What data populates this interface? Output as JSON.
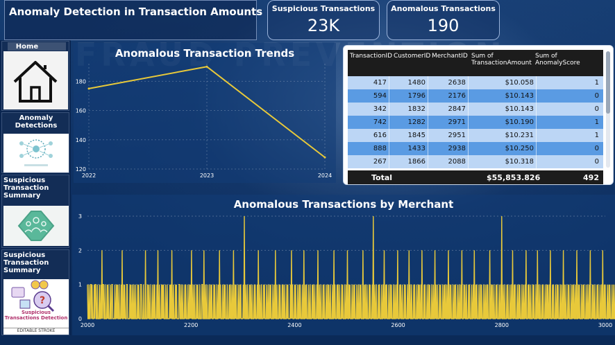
{
  "header": {
    "title": "Anomaly Detection in Transaction Amounts",
    "kpis": [
      {
        "label": "Suspicious Transactions",
        "value": "23K"
      },
      {
        "label": "Anomalous Transactions",
        "value": "190"
      }
    ]
  },
  "sidebar": {
    "items": [
      {
        "label": "Home",
        "icon": "home-icon"
      },
      {
        "label": "Anomaly Detections",
        "icon": "network-diagram-icon"
      },
      {
        "label": "Suspicious Transaction Summary",
        "icon": "people-diamond-icon"
      },
      {
        "label": "Suspicious Transaction Summary",
        "icon": "fraud-detection-icon",
        "thumb_text": "Suspicious Transactions Detection",
        "thumb_caption": "EDITABLE STROKE"
      }
    ]
  },
  "trends": {
    "title": "Anomalous Transaction Trends",
    "line_color": "#e8c93a"
  },
  "table": {
    "columns": [
      "TransactionID",
      "CustomerID",
      "MerchantID",
      "Sum of TransactionAmount",
      "Sum of AnomalyScore"
    ],
    "rows": [
      [
        "417",
        "1480",
        "2638",
        "$10.058",
        "1"
      ],
      [
        "594",
        "1796",
        "2176",
        "$10.143",
        "0"
      ],
      [
        "342",
        "1832",
        "2847",
        "$10.143",
        "0"
      ],
      [
        "742",
        "1282",
        "2971",
        "$10.190",
        "1"
      ],
      [
        "616",
        "1845",
        "2951",
        "$10.231",
        "1"
      ],
      [
        "888",
        "1433",
        "2938",
        "$10.250",
        "0"
      ],
      [
        "267",
        "1866",
        "2088",
        "$10.318",
        "0"
      ]
    ],
    "total": {
      "label": "Total",
      "amount": "$55,853.826",
      "score": "492"
    },
    "row_colors": [
      "#bcd6f5",
      "#5a9be3"
    ]
  },
  "merchant": {
    "title": "Anomalous Transactions by Merchant",
    "line_color": "#e8c93a"
  },
  "chart_data": [
    {
      "type": "line",
      "title": "Anomalous Transaction Trends",
      "x": [
        2022,
        2023,
        2024
      ],
      "values": [
        175,
        190,
        128
      ],
      "xlim": [
        2022,
        2024
      ],
      "ylim": [
        120,
        192
      ],
      "yticks": [
        120,
        140,
        160,
        180
      ],
      "xticks": [
        "2022",
        "2023",
        "2024"
      ],
      "grid": true
    },
    {
      "type": "area",
      "title": "Anomalous Transactions by Merchant",
      "xlim": [
        2000,
        3000
      ],
      "ylim": [
        0,
        3
      ],
      "xticks": [
        "2000",
        "2200",
        "2400",
        "2600",
        "2800",
        "3000"
      ],
      "yticks": [
        0,
        1,
        2,
        3
      ],
      "x_start": 2000,
      "x_step": 1,
      "values": [
        1,
        0,
        0,
        1,
        0,
        0,
        1,
        1,
        0,
        1,
        0,
        0,
        0,
        1,
        0,
        1,
        1,
        0,
        0,
        1,
        0,
        0,
        0,
        1,
        0,
        0,
        1,
        0,
        2,
        0,
        1,
        1,
        0,
        0,
        1,
        0,
        0,
        0,
        1,
        0,
        1,
        0,
        0,
        0,
        1,
        0,
        0,
        1,
        1,
        0,
        0,
        0,
        0,
        1,
        0,
        0,
        1,
        0,
        1,
        0,
        0,
        1,
        0,
        0,
        0,
        1,
        0,
        2,
        0,
        0,
        1,
        0,
        1,
        0,
        0,
        0,
        1,
        1,
        0,
        0,
        0,
        0,
        1,
        0,
        1,
        0,
        0,
        1,
        0,
        0,
        1,
        0,
        0,
        1,
        0,
        0,
        0,
        1,
        0,
        1,
        0,
        0,
        0,
        1,
        1,
        0,
        0,
        0,
        1,
        0,
        0,
        0,
        2,
        0,
        0,
        0,
        1,
        0,
        1,
        0,
        0,
        1,
        0,
        0,
        0,
        1,
        0,
        0,
        1,
        0,
        1,
        0,
        0,
        0,
        1,
        0,
        2,
        0,
        0,
        1,
        0,
        0,
        0,
        1,
        0,
        1,
        0,
        1,
        0,
        0,
        0,
        1,
        0,
        0,
        1,
        0,
        0,
        0,
        0,
        1,
        0,
        1,
        0,
        2,
        0,
        0,
        1,
        0,
        0,
        0,
        1,
        0,
        1,
        0,
        0,
        0,
        0,
        1,
        1,
        0,
        0,
        1,
        0,
        0,
        1,
        0,
        0,
        0,
        1,
        0,
        1,
        0,
        0,
        0,
        1,
        0,
        0,
        1,
        0,
        1,
        0,
        2,
        0,
        0,
        1,
        0,
        0,
        1,
        0,
        0,
        0,
        1,
        0,
        1,
        0,
        0,
        0,
        1,
        0,
        0,
        0,
        1,
        1,
        0,
        0,
        2,
        0,
        0,
        1,
        0,
        0,
        1,
        0,
        0,
        0,
        1,
        0,
        0,
        1,
        0,
        1,
        0,
        0,
        0,
        1,
        0,
        1,
        0,
        0,
        0,
        1,
        0,
        0,
        1,
        0,
        2,
        0,
        1,
        0,
        0,
        0,
        1,
        0,
        0,
        1,
        0,
        1,
        0,
        0,
        0,
        1,
        0,
        0,
        0,
        1,
        0,
        1,
        0,
        0,
        1,
        0,
        0,
        2,
        0,
        0,
        1,
        0,
        1,
        0,
        0,
        0,
        1,
        0,
        0,
        1,
        0,
        1,
        0,
        0,
        0,
        0,
        1,
        0,
        3,
        0,
        0,
        1,
        0,
        0,
        1,
        0,
        0,
        0,
        1,
        0,
        1,
        0,
        0,
        1,
        0,
        0,
        0,
        1,
        0,
        1,
        0,
        0,
        0,
        1,
        0,
        2,
        0,
        0,
        1,
        0,
        0,
        1,
        0,
        0,
        0,
        1,
        0,
        1,
        0,
        0,
        0,
        1,
        0,
        0,
        1,
        0,
        0,
        1,
        0,
        1,
        0,
        0,
        0,
        1,
        0,
        0,
        1,
        0,
        2,
        0,
        0,
        1,
        0,
        0,
        0,
        1,
        0,
        1,
        0,
        0,
        0,
        1,
        0,
        1,
        0,
        0,
        1,
        0,
        0,
        0,
        1,
        0,
        1,
        0,
        0,
        0,
        0,
        1,
        0,
        2,
        0,
        1,
        0,
        0,
        0,
        1,
        0,
        1,
        0,
        0,
        0,
        1,
        0,
        0,
        1,
        0,
        1,
        0,
        0,
        0,
        1,
        0,
        0,
        2,
        0,
        0,
        1,
        0,
        1,
        0,
        0,
        0,
        1,
        0,
        0,
        1,
        0,
        0,
        0,
        1,
        0,
        1,
        0,
        0,
        1,
        0,
        0,
        0,
        1,
        0,
        2,
        0,
        0,
        1,
        0,
        0,
        1,
        0,
        0,
        0,
        1,
        0,
        1,
        0,
        0,
        0,
        1,
        0,
        0,
        1,
        0,
        1,
        0,
        0,
        1,
        0,
        0,
        0,
        1,
        0,
        0,
        2,
        0,
        1,
        0,
        0,
        0,
        1,
        0,
        1,
        0,
        0,
        1,
        0,
        0,
        0,
        1,
        0,
        1,
        0,
        0,
        0,
        1,
        0,
        0,
        1,
        0,
        2,
        0,
        0,
        1,
        0,
        1,
        0,
        0,
        0,
        1,
        0,
        0,
        1,
        0,
        1,
        0,
        0,
        0,
        1,
        0,
        0,
        1,
        0,
        0,
        1,
        0,
        1,
        0,
        0,
        0,
        2,
        0,
        0,
        1,
        0,
        1,
        0,
        0,
        1,
        0,
        0,
        0,
        1,
        0,
        1,
        0,
        0,
        0,
        1,
        0,
        3,
        0,
        0,
        1,
        0,
        0,
        1,
        0,
        0,
        0,
        1,
        0,
        1,
        0,
        0,
        0,
        1,
        0,
        0,
        1,
        0,
        2,
        0,
        0,
        1,
        0,
        1,
        0,
        0,
        0,
        1,
        0,
        0,
        1,
        0,
        1,
        0,
        0,
        0,
        1,
        0,
        0,
        1,
        0,
        0,
        1,
        0,
        2,
        0,
        0,
        0,
        1,
        0,
        1,
        0,
        0,
        1,
        0,
        0,
        0,
        1,
        0,
        1,
        0,
        0,
        0,
        1,
        0,
        0,
        2,
        0,
        1,
        0,
        0,
        1,
        0,
        0,
        0,
        1,
        0,
        1,
        0,
        0,
        0,
        1,
        0,
        0,
        1,
        0,
        1,
        0,
        0,
        1,
        0,
        2,
        0,
        0,
        0,
        1,
        0,
        1,
        0,
        0,
        0,
        1,
        0,
        0,
        1,
        0,
        1,
        0,
        0,
        0,
        1,
        0,
        0,
        1,
        0,
        0,
        2,
        0,
        1,
        0,
        0,
        1,
        0,
        0,
        0,
        1,
        0,
        1,
        0,
        0,
        0,
        1,
        0,
        0,
        1,
        0,
        1,
        0,
        0,
        1,
        0,
        0,
        2,
        0,
        0,
        1,
        0,
        1,
        0,
        0,
        0,
        1,
        0,
        0,
        1,
        0,
        1,
        0,
        0,
        0,
        1,
        0,
        0,
        1,
        0,
        0,
        1,
        0,
        2,
        0,
        0,
        0,
        1,
        0,
        1,
        0,
        0,
        1,
        0,
        0,
        0,
        1,
        0,
        1,
        0,
        0,
        0,
        1,
        0,
        0,
        1,
        0,
        2,
        0,
        0,
        1,
        0,
        1,
        0,
        0,
        0,
        1,
        0,
        0,
        1,
        0,
        1,
        0,
        0,
        0,
        1,
        0,
        0,
        1,
        0,
        0,
        1,
        0,
        1,
        0,
        0,
        0,
        2,
        0,
        0,
        1,
        0,
        1,
        0,
        0,
        1,
        0,
        0,
        0,
        1,
        0,
        1,
        0,
        0,
        0,
        1,
        0,
        0,
        1,
        0,
        3,
        0,
        0,
        1,
        0,
        0,
        1,
        0,
        0,
        0,
        1,
        0,
        1,
        0,
        0,
        0,
        1,
        0,
        0,
        1,
        0,
        2,
        0,
        0,
        1,
        0,
        1,
        0,
        0,
        0,
        1,
        0,
        0,
        1,
        0,
        1,
        0,
        0,
        0,
        1,
        0,
        0,
        1,
        0,
        0,
        1,
        0,
        2,
        0,
        0,
        0,
        1,
        0,
        1,
        0,
        0,
        1,
        0,
        0,
        0,
        1,
        0,
        1,
        0,
        0,
        0,
        1,
        0,
        0,
        2,
        0,
        1,
        0,
        0,
        1,
        0,
        0,
        0,
        1,
        0,
        1,
        0,
        0,
        0,
        1,
        0,
        0,
        1,
        0,
        1,
        0,
        0,
        1,
        0,
        2,
        0,
        0,
        0,
        1,
        0,
        1,
        0,
        0,
        0,
        1,
        0,
        0,
        1,
        0,
        1,
        0,
        0,
        0,
        1,
        0,
        0,
        1,
        0,
        0,
        2,
        0,
        1,
        0,
        0,
        1,
        0,
        0,
        0,
        1,
        0,
        1,
        0,
        0,
        0,
        1,
        0,
        0,
        1,
        0,
        1,
        0,
        0,
        1,
        0,
        0,
        2,
        0,
        0,
        1,
        0,
        1,
        0,
        0,
        0,
        1,
        0,
        0,
        1,
        0,
        1,
        0,
        0,
        0,
        1,
        0,
        0,
        1,
        0,
        0,
        1,
        0,
        2,
        0,
        0,
        0,
        1,
        0,
        1,
        0,
        0,
        1,
        0,
        0,
        0,
        1,
        0,
        1,
        0,
        0,
        0,
        1,
        0,
        0,
        1,
        0,
        2,
        0,
        0,
        1,
        0,
        1,
        0,
        0,
        0,
        1,
        0,
        0,
        1,
        0,
        1,
        0,
        0,
        0,
        1,
        0,
        0,
        1,
        0,
        0,
        1,
        0,
        1,
        0,
        0,
        0,
        2,
        0,
        0,
        1,
        0,
        1,
        0,
        0,
        1,
        0,
        0,
        0,
        1,
        0,
        1,
        0,
        0,
        0,
        1,
        0,
        0,
        1,
        0,
        2,
        0,
        0,
        1,
        0,
        0,
        1,
        0,
        0,
        0,
        1,
        0,
        1,
        0,
        0,
        0,
        1,
        0,
        0,
        1,
        0,
        2,
        0,
        0,
        1,
        0,
        1,
        0,
        0,
        0,
        1,
        0,
        0,
        1,
        0,
        1,
        0,
        0,
        0,
        1,
        0,
        0,
        1,
        0,
        0,
        1,
        0
      ]
    }
  ]
}
